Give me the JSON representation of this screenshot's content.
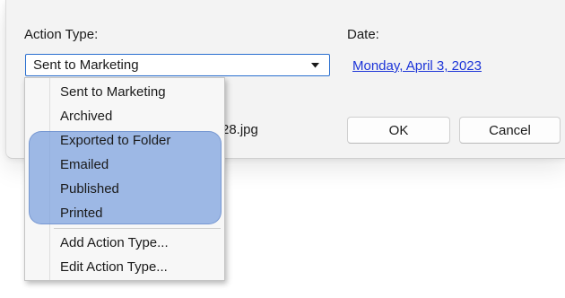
{
  "dialog": {
    "action_type_label": "Action Type:",
    "date_label": "Date:",
    "selected_action": "Sent to Marketing",
    "date_value": "Monday, April 3, 2023",
    "filename_fragment": "28.jpg",
    "ok_label": "OK",
    "cancel_label": "Cancel",
    "link_color": "#1c34d8",
    "focus_color": "#2a6fd0"
  },
  "dropdown": {
    "items": [
      "Sent to Marketing",
      "Archived",
      "Exported to Folder",
      "Emailed",
      "Published",
      "Printed"
    ],
    "commands": [
      "Add Action Type...",
      "Edit Action Type..."
    ],
    "highlighted_items": [
      "Exported to Folder",
      "Emailed",
      "Published",
      "Printed"
    ],
    "highlight_color": "#7aa0de"
  },
  "icons": {
    "combo_arrow": "chevron-down-icon"
  }
}
